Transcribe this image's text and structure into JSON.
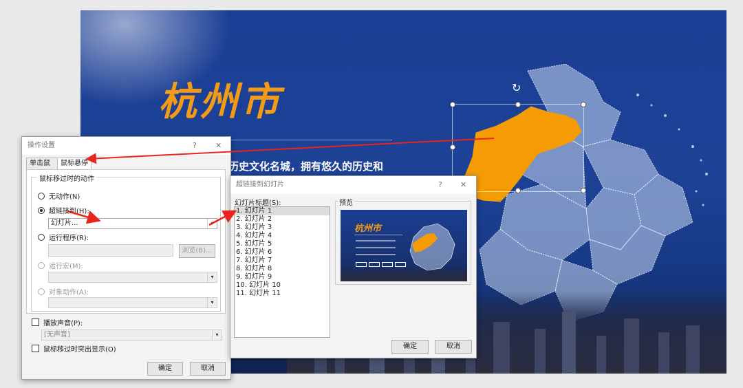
{
  "slide": {
    "title": "杭州市",
    "text": "历史文化名城，拥有悠久的历史和",
    "map_color": "#f59c05",
    "bg_color": "#1d4296"
  },
  "action_dialog": {
    "title": "操作设置",
    "help": "?",
    "close": "✕",
    "tabs": [
      "单击鼠标",
      "鼠标悬停"
    ],
    "group_label": "鼠标移过时的动作",
    "options": {
      "none": "无动作(N)",
      "hyperlink": "超链接到(H):",
      "run_program": "运行程序(R):",
      "run_macro": "运行宏(M):",
      "object_action": "对象动作(A):"
    },
    "hyperlink_value": "幻灯片...",
    "browse_button": "浏览(B)...",
    "play_sound": "播放声音(P):",
    "sound_value": "[无声音]",
    "highlight": "鼠标移过时突出显示(O)",
    "ok": "确定",
    "cancel": "取消"
  },
  "slide_dialog": {
    "title": "超链接到幻灯片",
    "help": "?",
    "close": "✕",
    "list_label": "幻灯片标题(S):",
    "preview_label": "预览",
    "items": [
      "1. 幻灯片 1",
      "2. 幻灯片 2",
      "3. 幻灯片 3",
      "4. 幻灯片 4",
      "5. 幻灯片 5",
      "6. 幻灯片 6",
      "7. 幻灯片 7",
      "8. 幻灯片 8",
      "9. 幻灯片 9",
      "10. 幻灯片 10",
      "11. 幻灯片 11"
    ],
    "preview_title": "杭州市",
    "ok": "确定",
    "cancel": "取消"
  },
  "annotation_color": "#e8261e"
}
